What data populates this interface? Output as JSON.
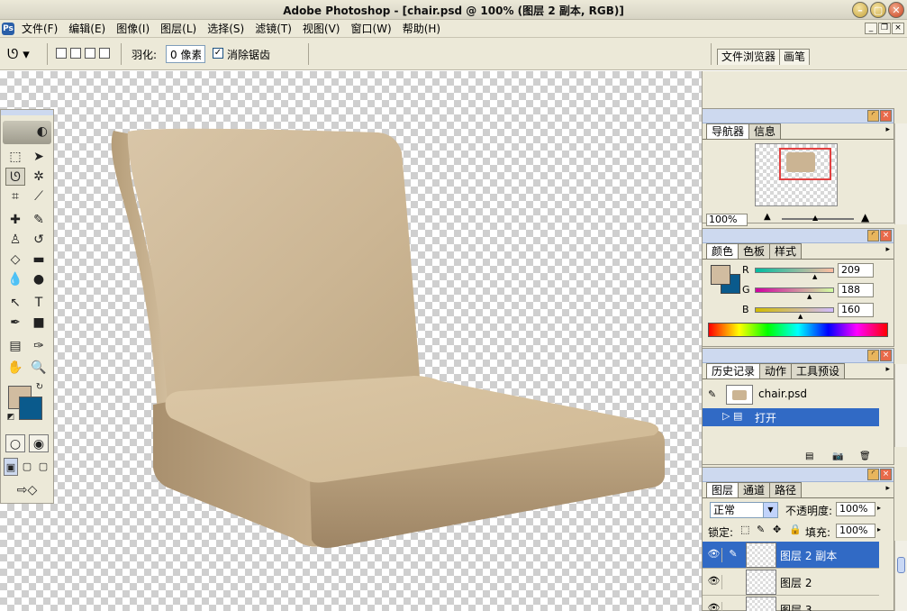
{
  "window": {
    "title": "Adobe Photoshop - [chair.psd @ 100% (图层 2 副本, RGB)]"
  },
  "menu": [
    "文件(F)",
    "编辑(E)",
    "图像(I)",
    "图层(L)",
    "选择(S)",
    "滤镜(T)",
    "视图(V)",
    "窗口(W)",
    "帮助(H)"
  ],
  "options": {
    "feather_label": "羽化:",
    "feather_value": "0 像素",
    "antialias_label": "消除锯齿",
    "antialias_checked": true
  },
  "palette_well": {
    "tabs": [
      "文件浏览器",
      "画笔"
    ]
  },
  "canvas": {
    "colors": {
      "seat": "#d1bca0",
      "checker": "#cfcfcf"
    }
  },
  "tools": {
    "icons": [
      "marquee-icon",
      "move-icon",
      "lasso-icon",
      "magic-wand-icon",
      "crop-icon",
      "slice-icon",
      "healing-brush-icon",
      "brush-icon",
      "clone-stamp-icon",
      "history-brush-icon",
      "eraser-icon",
      "gradient-icon",
      "blur-icon",
      "dodge-icon",
      "path-selection-icon",
      "type-icon",
      "pen-icon",
      "shape-icon",
      "notes-icon",
      "eyedropper-icon",
      "hand-icon",
      "zoom-icon"
    ],
    "foreground_color": "#d1bca0",
    "background_color": "#0a5a8c"
  },
  "navigator": {
    "tabs": [
      "导航器",
      "信息"
    ],
    "zoom": "100%"
  },
  "color_panel": {
    "tabs": [
      "颜色",
      "色板",
      "样式"
    ],
    "channels": [
      {
        "label": "R",
        "value": "209"
      },
      {
        "label": "G",
        "value": "188"
      },
      {
        "label": "B",
        "value": "160"
      }
    ],
    "foreground": "#d1bca0",
    "background": "#0a5a8c"
  },
  "history": {
    "tabs": [
      "历史记录",
      "动作",
      "工具预设"
    ],
    "snapshot": "chair.psd",
    "states": [
      "打开"
    ]
  },
  "layers": {
    "tabs": [
      "图层",
      "通道",
      "路径"
    ],
    "blend_mode": "正常",
    "opacity_label": "不透明度:",
    "opacity": "100%",
    "lock_label": "锁定:",
    "fill_label": "填充:",
    "fill": "100%",
    "items": [
      {
        "name": "图层 2 副本",
        "selected": true
      },
      {
        "name": "图层 2",
        "selected": false
      },
      {
        "name": "图层 3",
        "selected": false
      }
    ]
  }
}
